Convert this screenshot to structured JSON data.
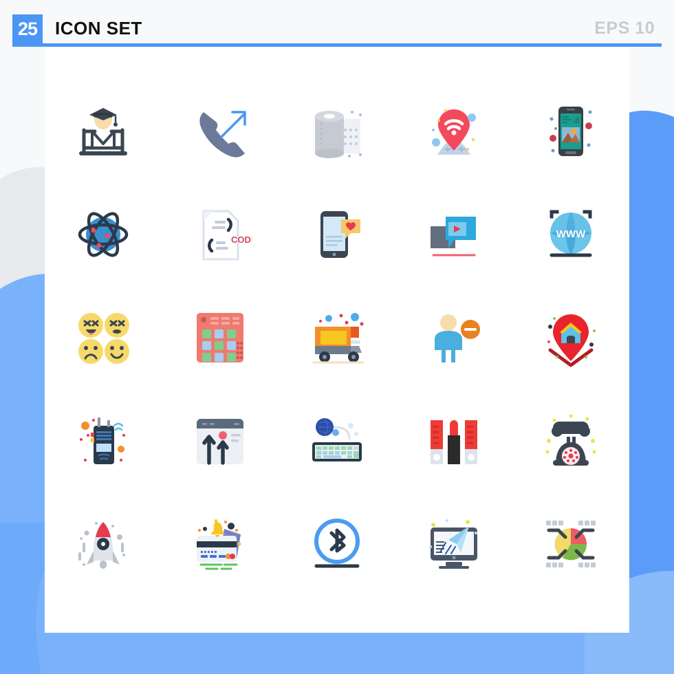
{
  "header": {
    "badge_count": "25",
    "title": "ICON SET",
    "eps_label": "EPS 10",
    "badge_color": "#4a96f5",
    "rule_color": "#4a96f5",
    "title_color": "#111111",
    "eps_color": "#c7ccd1"
  },
  "background": {
    "page_color": "#f7f9fb",
    "card_color": "#ffffff",
    "wave_blue_light": "#79b2fa",
    "wave_blue_dark": "#5a9cf8",
    "wave_gray": "#e6eaed"
  },
  "palette": {
    "blue": "#4a96f5",
    "red": "#f4485b",
    "dark_slate": "#3b4652",
    "slate_gray": "#6b7a99",
    "light_gray": "#c6cbd3",
    "yellow": "#f7d04a",
    "green": "#7cc576",
    "orange": "#f08a24",
    "teal": "#1a9e8f",
    "cyan": "#41b6e6"
  },
  "grid": {
    "columns": 5,
    "rows": 5,
    "total_icons": 25
  },
  "icons": [
    {
      "id": "graduate-desk",
      "name": "graduate-student-icon",
      "label": "Graduate at desk",
      "row": 1,
      "col": 1
    },
    {
      "id": "outgoing-call",
      "name": "outgoing-call-icon",
      "label": "Outgoing call",
      "row": 1,
      "col": 2
    },
    {
      "id": "toilet-paper",
      "name": "toilet-paper-icon",
      "label": "Toilet paper roll",
      "row": 1,
      "col": 3
    },
    {
      "id": "wifi-location",
      "name": "wifi-location-pin-icon",
      "label": "Wifi location pin",
      "row": 1,
      "col": 4
    },
    {
      "id": "phone-gallery",
      "name": "smartphone-gallery-icon",
      "label": "Smartphone image",
      "row": 1,
      "col": 5
    },
    {
      "id": "atom",
      "name": "atom-science-icon",
      "label": "Atom science",
      "row": 2,
      "col": 1
    },
    {
      "id": "code-file",
      "name": "code-file-icon",
      "label": "Code file",
      "row": 2,
      "col": 2,
      "text": "CODE"
    },
    {
      "id": "mobile-heart",
      "name": "mobile-love-message-icon",
      "label": "Mobile love message",
      "row": 2,
      "col": 3
    },
    {
      "id": "video-chat",
      "name": "video-message-icon",
      "label": "Video message",
      "row": 2,
      "col": 4
    },
    {
      "id": "www-globe",
      "name": "www-globe-icon",
      "label": "World wide web globe",
      "row": 2,
      "col": 5,
      "text": "WWW"
    },
    {
      "id": "emoji-set",
      "name": "emoticons-icon",
      "label": "Emoticon faces",
      "row": 3,
      "col": 1
    },
    {
      "id": "drum-pad",
      "name": "drum-machine-icon",
      "label": "Drum machine pad",
      "row": 3,
      "col": 2
    },
    {
      "id": "delivery-truck",
      "name": "delivery-truck-icon",
      "label": "Delivery truck",
      "row": 3,
      "col": 3
    },
    {
      "id": "remove-user",
      "name": "remove-user-icon",
      "label": "Remove user",
      "row": 3,
      "col": 4
    },
    {
      "id": "home-location",
      "name": "home-location-pin-icon",
      "label": "Home location pin",
      "row": 3,
      "col": 5
    },
    {
      "id": "walkie-talkie",
      "name": "walkie-talkie-icon",
      "label": "Walkie talkie",
      "row": 4,
      "col": 1
    },
    {
      "id": "browser-growth",
      "name": "browser-upload-icon",
      "label": "Browser growth arrows",
      "row": 4,
      "col": 2
    },
    {
      "id": "keyboard-mouse",
      "name": "keyboard-mouse-icon",
      "label": "Keyboard and mouse",
      "row": 4,
      "col": 3
    },
    {
      "id": "lipstick",
      "name": "lipstick-icon",
      "label": "Lipstick set",
      "row": 4,
      "col": 4
    },
    {
      "id": "rotary-phone",
      "name": "rotary-telephone-icon",
      "label": "Rotary telephone",
      "row": 4,
      "col": 5
    },
    {
      "id": "rocket",
      "name": "rocket-startup-icon",
      "label": "Rocket startup",
      "row": 5,
      "col": 1
    },
    {
      "id": "card-alert",
      "name": "card-notification-icon",
      "label": "Credit card alert",
      "row": 5,
      "col": 2
    },
    {
      "id": "bluetooth",
      "name": "bluetooth-icon",
      "label": "Bluetooth",
      "row": 5,
      "col": 3
    },
    {
      "id": "monitor-send",
      "name": "monitor-send-icon",
      "label": "Monitor paper plane",
      "row": 5,
      "col": 4
    },
    {
      "id": "pie-network",
      "name": "pie-chart-network-icon",
      "label": "Pie chart network",
      "row": 5,
      "col": 5
    }
  ]
}
